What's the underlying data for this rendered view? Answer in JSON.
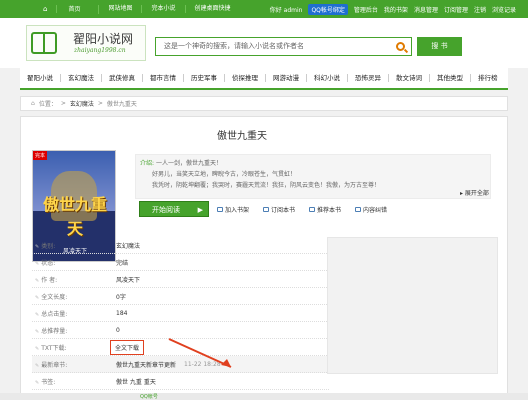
{
  "topbar": {
    "left": [
      "首页",
      "网站地图",
      "完本小说",
      "创建桌面快捷"
    ],
    "greeting": "你好 admin",
    "qq_badge": "QQ帐号绑定",
    "right_links": [
      "管理后台",
      "我的书架",
      "消息管理",
      "订阅管理",
      "注销"
    ],
    "history": "浏览记录"
  },
  "logo": {
    "name": "翟阳小说网",
    "url": "zhaiyang1998.cn"
  },
  "search": {
    "placeholder": "这是一个神奇的搜索，请输入小说名或作者名",
    "button": "搜 书"
  },
  "nav": [
    "翟阳小说",
    "玄幻魔法",
    "武侠修真",
    "都市言情",
    "历史军事",
    "侦探推理",
    "网游动漫",
    "科幻小说",
    "恐怖灵异",
    "散文诗词",
    "其他类型",
    "排行榜"
  ],
  "breadcrumb": {
    "location": "位置：",
    "sep": ">",
    "category": "玄幻魔法",
    "current": "傲世九重天"
  },
  "book": {
    "title": "傲世九重天",
    "cover_title": "傲世九重天",
    "cover_author": "风凌天下",
    "cover_tag": "完本",
    "intro_label": "介绍:",
    "intro_lines": [
      "一人一剑，傲世九重天！",
      "好男儿，当笑天立地，睥睨今古，冷眼苍生，气贯虹！",
      "我凭时，阴乾坤翻覆；我哭时，赛霾天荒流！我狂，阴风云变色！我傲，为万古至尊！"
    ],
    "expand": "展开全部",
    "read_button": "开始阅读",
    "actions": [
      "加入书架",
      "订阅本书",
      "推荐本书",
      "内容纠错"
    ]
  },
  "info": [
    {
      "k": "类别:",
      "v": "玄幻魔法"
    },
    {
      "k": "状态:",
      "v": "完结"
    },
    {
      "k": "作 者:",
      "v": "风凌天下"
    },
    {
      "k": "全文长度:",
      "v": "0字"
    },
    {
      "k": "总点击量:",
      "v": "184"
    },
    {
      "k": "总推荐量:",
      "v": "0"
    },
    {
      "k": "TXT下载:",
      "v": "全文下载"
    },
    {
      "k": "最新章节:",
      "v": "傲世九重天新章节更新",
      "time": "11-22 18:28"
    },
    {
      "k": "书签:",
      "v": "傲世 九重 重天"
    }
  ],
  "footer_note": "QQ帐号",
  "colors": {
    "brand": "#46a32c",
    "highlight": "#e0401f"
  }
}
